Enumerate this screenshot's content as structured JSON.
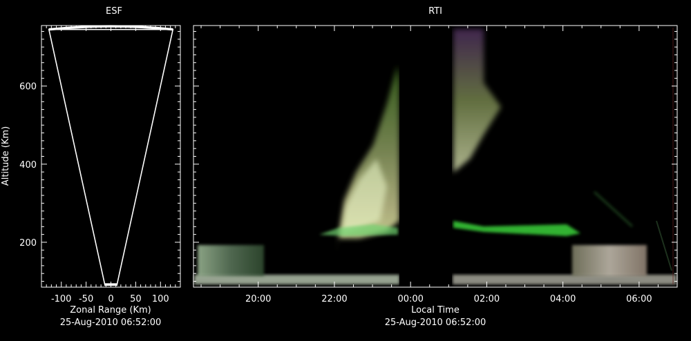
{
  "esf": {
    "title": "ESF",
    "xlabel": "Zonal Range (Km)",
    "ylabel": "Altitude (Km)",
    "timestamp": "25-Aug-2010 06:52:00",
    "xticks": [
      {
        "v": -100,
        "label": "-100"
      },
      {
        "v": -50,
        "label": "-50"
      },
      {
        "v": 0,
        "label": "0"
      },
      {
        "v": 50,
        "label": "50"
      },
      {
        "v": 100,
        "label": "100"
      }
    ],
    "yticks": [
      {
        "v": 200,
        "label": "200"
      },
      {
        "v": 400,
        "label": "400"
      },
      {
        "v": 600,
        "label": "600"
      }
    ]
  },
  "rti": {
    "title": "RTI",
    "xlabel": "Local Time",
    "timestamp": "25-Aug-2010 06:52:00",
    "xticks": [
      {
        "v": 20,
        "label": "20:00"
      },
      {
        "v": 22,
        "label": "22:00"
      },
      {
        "v": 24,
        "label": "00:00"
      },
      {
        "v": 26,
        "label": "02:00"
      },
      {
        "v": 28,
        "label": "04:00"
      },
      {
        "v": 30,
        "label": "06:00"
      }
    ]
  },
  "chart_data": [
    {
      "type": "scatter",
      "title": "ESF",
      "xlabel": "Zonal Range (Km)",
      "ylabel": "Altitude (Km)",
      "xlim": [
        -140,
        140
      ],
      "ylim": [
        85,
        755
      ],
      "beam_fan": {
        "apex_altitude": 90,
        "apex_halfwidth": 12,
        "top_altitude": 745,
        "top_halfwidth": 125
      },
      "grid": false,
      "colors": {
        "outline": "#ffffff",
        "background": "#000000"
      }
    },
    {
      "type": "heatmap",
      "title": "RTI",
      "xlabel": "Local Time",
      "ylabel": "Altitude (Km)",
      "xlim": [
        18.3,
        31.0
      ],
      "ylim": [
        85,
        755
      ],
      "data_gap": [
        23.4,
        24.9
      ],
      "features": [
        {
          "name": "bottomside layer",
          "x_start": 18.3,
          "x_end": 31.0,
          "altitude": [
            95,
            115
          ]
        },
        {
          "name": "plume",
          "x_start": 21.8,
          "x_end": 23.4,
          "altitude": [
            150,
            620
          ]
        },
        {
          "name": "green layer",
          "x_start": 25.0,
          "x_end": 29.0,
          "altitude": [
            225,
            240
          ]
        },
        {
          "name": "E-region echoes",
          "x_start": 18.4,
          "x_end": 20.4,
          "altitude": [
            115,
            185
          ]
        },
        {
          "name": "E-region echoes",
          "x_start": 29.4,
          "x_end": 30.4,
          "altitude": [
            115,
            185
          ]
        }
      ],
      "grid": false,
      "colors": {
        "axis": "#ffffff",
        "green": "#3ad23a",
        "background": "#000000"
      }
    }
  ]
}
